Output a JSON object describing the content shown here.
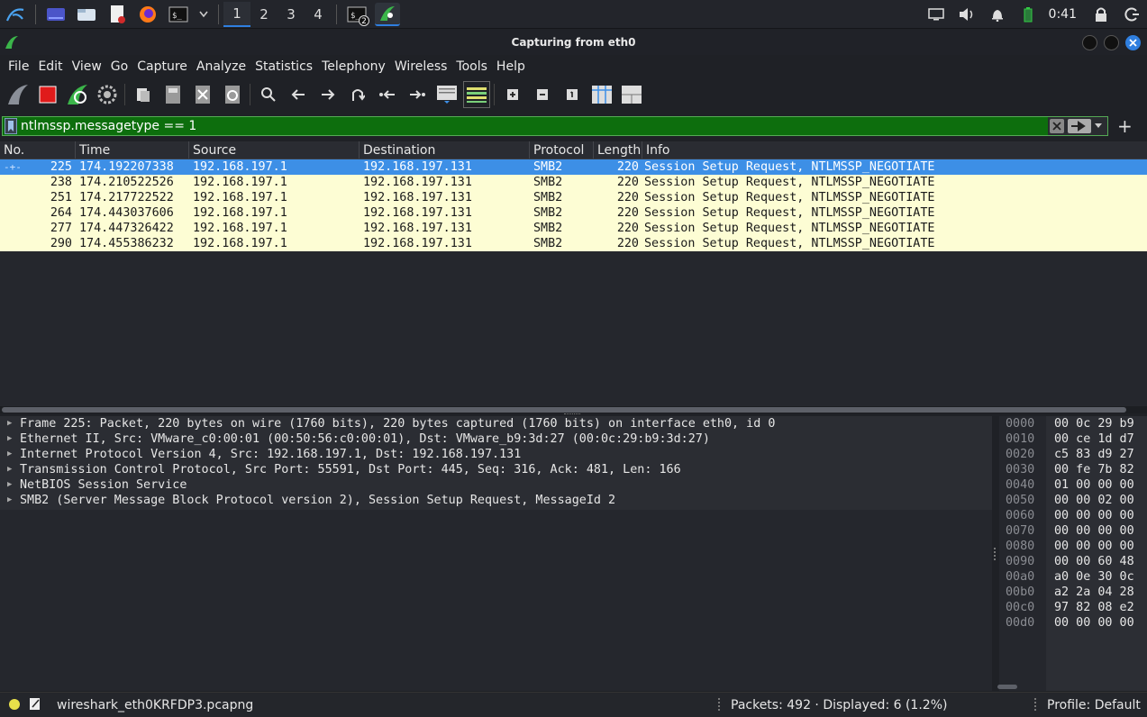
{
  "taskbar": {
    "workspaces": [
      "1",
      "2",
      "3",
      "4"
    ],
    "active_workspace": "1",
    "terminal_badge": "2",
    "clock": "0:41"
  },
  "window": {
    "title": "Capturing from eth0"
  },
  "menu": {
    "items": [
      "File",
      "Edit",
      "View",
      "Go",
      "Capture",
      "Analyze",
      "Statistics",
      "Telephony",
      "Wireless",
      "Tools",
      "Help"
    ]
  },
  "filter": {
    "value": "ntlmssp.messagetype == 1",
    "plus": "+"
  },
  "packet_list": {
    "columns": [
      "No.",
      "Time",
      "Source",
      "Destination",
      "Protocol",
      "Length",
      "Info"
    ],
    "rows": [
      {
        "no": "225",
        "time": "174.192207338",
        "src": "192.168.197.1",
        "dst": "192.168.197.131",
        "proto": "SMB2",
        "len": "220",
        "info": "Session Setup Request, NTLMSSP_NEGOTIATE"
      },
      {
        "no": "238",
        "time": "174.210522526",
        "src": "192.168.197.1",
        "dst": "192.168.197.131",
        "proto": "SMB2",
        "len": "220",
        "info": "Session Setup Request, NTLMSSP_NEGOTIATE"
      },
      {
        "no": "251",
        "time": "174.217722522",
        "src": "192.168.197.1",
        "dst": "192.168.197.131",
        "proto": "SMB2",
        "len": "220",
        "info": "Session Setup Request, NTLMSSP_NEGOTIATE"
      },
      {
        "no": "264",
        "time": "174.443037606",
        "src": "192.168.197.1",
        "dst": "192.168.197.131",
        "proto": "SMB2",
        "len": "220",
        "info": "Session Setup Request, NTLMSSP_NEGOTIATE"
      },
      {
        "no": "277",
        "time": "174.447326422",
        "src": "192.168.197.1",
        "dst": "192.168.197.131",
        "proto": "SMB2",
        "len": "220",
        "info": "Session Setup Request, NTLMSSP_NEGOTIATE"
      },
      {
        "no": "290",
        "time": "174.455386232",
        "src": "192.168.197.1",
        "dst": "192.168.197.131",
        "proto": "SMB2",
        "len": "220",
        "info": "Session Setup Request, NTLMSSP_NEGOTIATE"
      }
    ]
  },
  "details": {
    "rows": [
      "Frame 225: Packet, 220 bytes on wire (1760 bits), 220 bytes captured (1760 bits) on interface eth0, id 0",
      "Ethernet II, Src: VMware_c0:00:01 (00:50:56:c0:00:01), Dst: VMware_b9:3d:27 (00:0c:29:b9:3d:27)",
      "Internet Protocol Version 4, Src: 192.168.197.1, Dst: 192.168.197.131",
      "Transmission Control Protocol, Src Port: 55591, Dst Port: 445, Seq: 316, Ack: 481, Len: 166",
      "NetBIOS Session Service",
      "SMB2 (Server Message Block Protocol version 2), Session Setup Request, MessageId 2"
    ]
  },
  "bytes": {
    "rows": [
      {
        "off": "0000",
        "hex": "00 0c 29 b9"
      },
      {
        "off": "0010",
        "hex": "00 ce 1d d7"
      },
      {
        "off": "0020",
        "hex": "c5 83 d9 27"
      },
      {
        "off": "0030",
        "hex": "00 fe 7b 82"
      },
      {
        "off": "0040",
        "hex": "01 00 00 00"
      },
      {
        "off": "0050",
        "hex": "00 00 02 00"
      },
      {
        "off": "0060",
        "hex": "00 00 00 00"
      },
      {
        "off": "0070",
        "hex": "00 00 00 00"
      },
      {
        "off": "0080",
        "hex": "00 00 00 00"
      },
      {
        "off": "0090",
        "hex": "00 00 60 48"
      },
      {
        "off": "00a0",
        "hex": "a0 0e 30 0c"
      },
      {
        "off": "00b0",
        "hex": "a2 2a 04 28"
      },
      {
        "off": "00c0",
        "hex": "97 82 08 e2"
      },
      {
        "off": "00d0",
        "hex": "00 00 00 00"
      }
    ]
  },
  "status": {
    "file": "wireshark_eth0KRFDP3.pcapng",
    "packets": "Packets: 492 · Displayed: 6 (1.2%)",
    "profile": "Profile: Default"
  },
  "colors": {
    "filter_valid": "#0d6e0d",
    "row_selected": "#3d8fe6",
    "row_smb": "#fdfdd4"
  }
}
